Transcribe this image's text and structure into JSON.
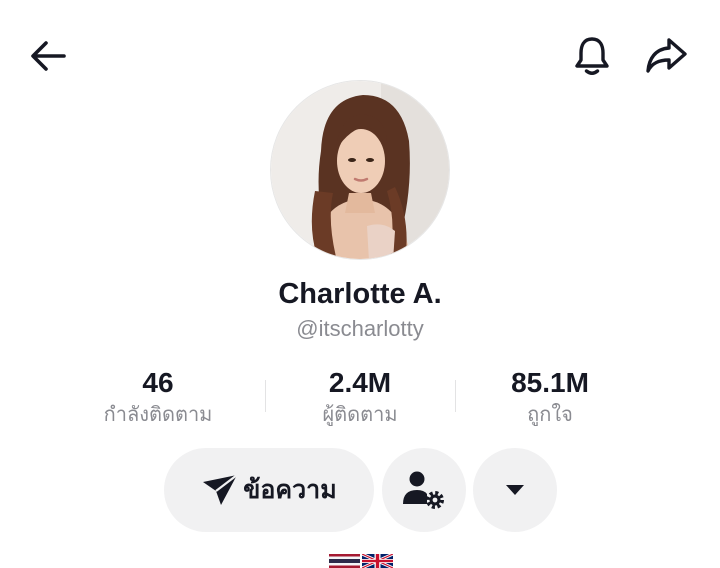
{
  "header": {
    "back_icon": "arrow-left-icon",
    "bell_icon": "bell-icon",
    "share_icon": "share-arrow-icon"
  },
  "profile": {
    "display_name": "Charlotte A.",
    "handle": "@itscharlotty",
    "avatar": "profile-photo"
  },
  "stats": [
    {
      "value": "46",
      "label": "กำลังติดตาม"
    },
    {
      "value": "2.4M",
      "label": "ผู้ติดตาม"
    },
    {
      "value": "85.1M",
      "label": "ถูกใจ"
    }
  ],
  "actions": {
    "message_label": "ข้อความ",
    "message_icon": "send-icon",
    "friend_icon": "user-settings-icon",
    "more_icon": "caret-down-icon"
  },
  "bio": {
    "flags": [
      "thailand-flag",
      "uk-flag"
    ]
  },
  "colors": {
    "text_primary": "#161823",
    "text_secondary": "#8a8b91",
    "button_bg": "#f1f1f2"
  }
}
